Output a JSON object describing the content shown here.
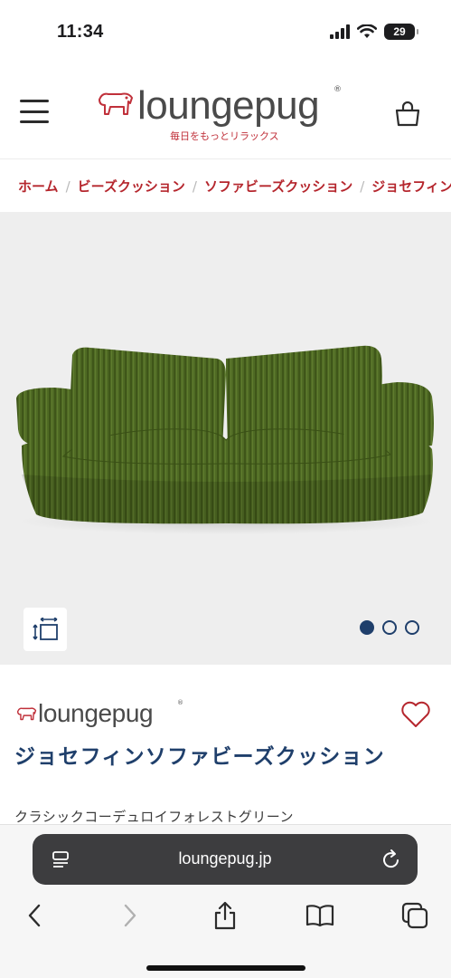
{
  "status_bar": {
    "time": "11:34",
    "battery": "29"
  },
  "header": {
    "brand_name": "loungepug",
    "brand_reg": "®",
    "tagline": "毎日をもっとリラックス"
  },
  "breadcrumb": {
    "items": [
      "ホーム",
      "ビーズクッション",
      "ソファビーズクッション",
      "ジョセフィンソファビーズクッション"
    ],
    "separator": "/"
  },
  "gallery": {
    "image_count": 3,
    "active_index": 0,
    "product_color": "#4f6a24"
  },
  "product": {
    "brand_name": "loungepug",
    "brand_reg": "®",
    "title": "ジョセフィンソファビーズクッション",
    "variant": "クラシックコーデュロイフォレストグリーン"
  },
  "browser": {
    "url": "loungepug.jp"
  },
  "colors": {
    "accent_red": "#b5262d",
    "navy": "#1f3f6b",
    "sofa_green": "#4f6a24"
  }
}
